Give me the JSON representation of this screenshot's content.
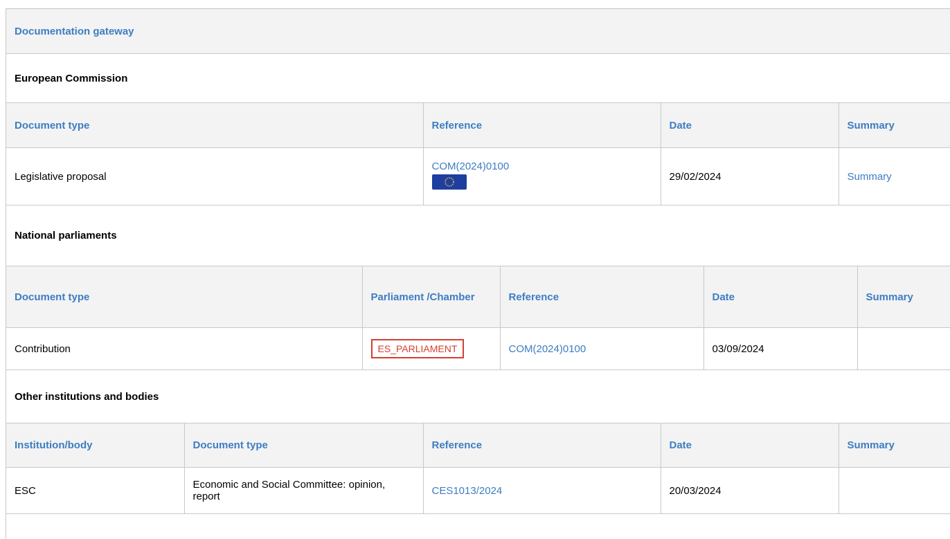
{
  "gateway": {
    "title": "Documentation gateway"
  },
  "commission": {
    "title": "European Commission",
    "headers": {
      "doc_type": "Document type",
      "reference": "Reference",
      "date": "Date",
      "summary": "Summary"
    },
    "row": {
      "doc_type": "Legislative proposal",
      "reference": "COM(2024)0100",
      "date": "29/02/2024",
      "summary": "Summary"
    }
  },
  "parliaments": {
    "title": "National parliaments",
    "headers": {
      "doc_type": "Document type",
      "parliament": "Parliament /Chamber",
      "reference": "Reference",
      "date": "Date",
      "summary": "Summary"
    },
    "row": {
      "doc_type": "Contribution",
      "parliament": "ES_PARLIAMENT",
      "reference": "COM(2024)0100",
      "date": "03/09/2024",
      "summary": ""
    }
  },
  "other": {
    "title": "Other institutions and bodies",
    "headers": {
      "institution": "Institution/body",
      "doc_type": "Document type",
      "reference": "Reference",
      "date": "Date",
      "summary": "Summary"
    },
    "row": {
      "institution": "ESC",
      "doc_type": "Economic and Social Committee: opinion, report",
      "reference": "CES1013/2024",
      "date": "20/03/2024",
      "summary": ""
    }
  },
  "colors": {
    "link": "#3d7dc3",
    "badge": "#d3402f",
    "header_bg": "#f3f3f3",
    "border": "#c8c8c8"
  },
  "icons": {
    "eu_flag": "eu-flag-icon"
  }
}
